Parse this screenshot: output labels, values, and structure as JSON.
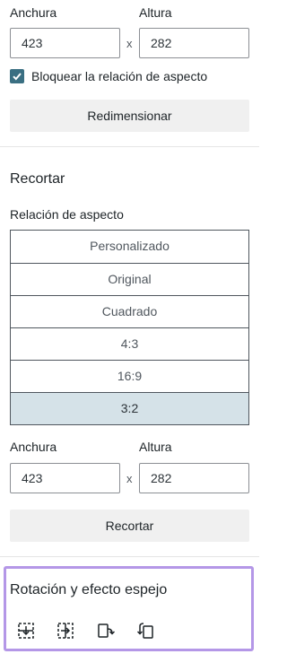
{
  "resize": {
    "width_label": "Anchura",
    "height_label": "Altura",
    "width_value": "423",
    "height_value": "282",
    "times": "x",
    "lock_label": "Bloquear la relación de aspecto",
    "lock_checked": true,
    "button_label": "Redimensionar"
  },
  "crop": {
    "title": "Recortar",
    "ratio_label": "Relación de aspecto",
    "ratios": [
      "Personalizado",
      "Original",
      "Cuadrado",
      "4:3",
      "16:9",
      "3:2"
    ],
    "selected_ratio": "3:2",
    "width_label": "Anchura",
    "height_label": "Altura",
    "width_value": "423",
    "height_value": "282",
    "times": "x",
    "button_label": "Recortar"
  },
  "rotation": {
    "title": "Rotación y efecto espejo",
    "icons": [
      "flip-vertical-icon",
      "flip-horizontal-icon",
      "rotate-right-icon",
      "rotate-left-icon"
    ]
  },
  "colors": {
    "accent": "#3a6f82",
    "selected_bg": "#d5e2e8",
    "highlight_border": "#b497e7"
  }
}
